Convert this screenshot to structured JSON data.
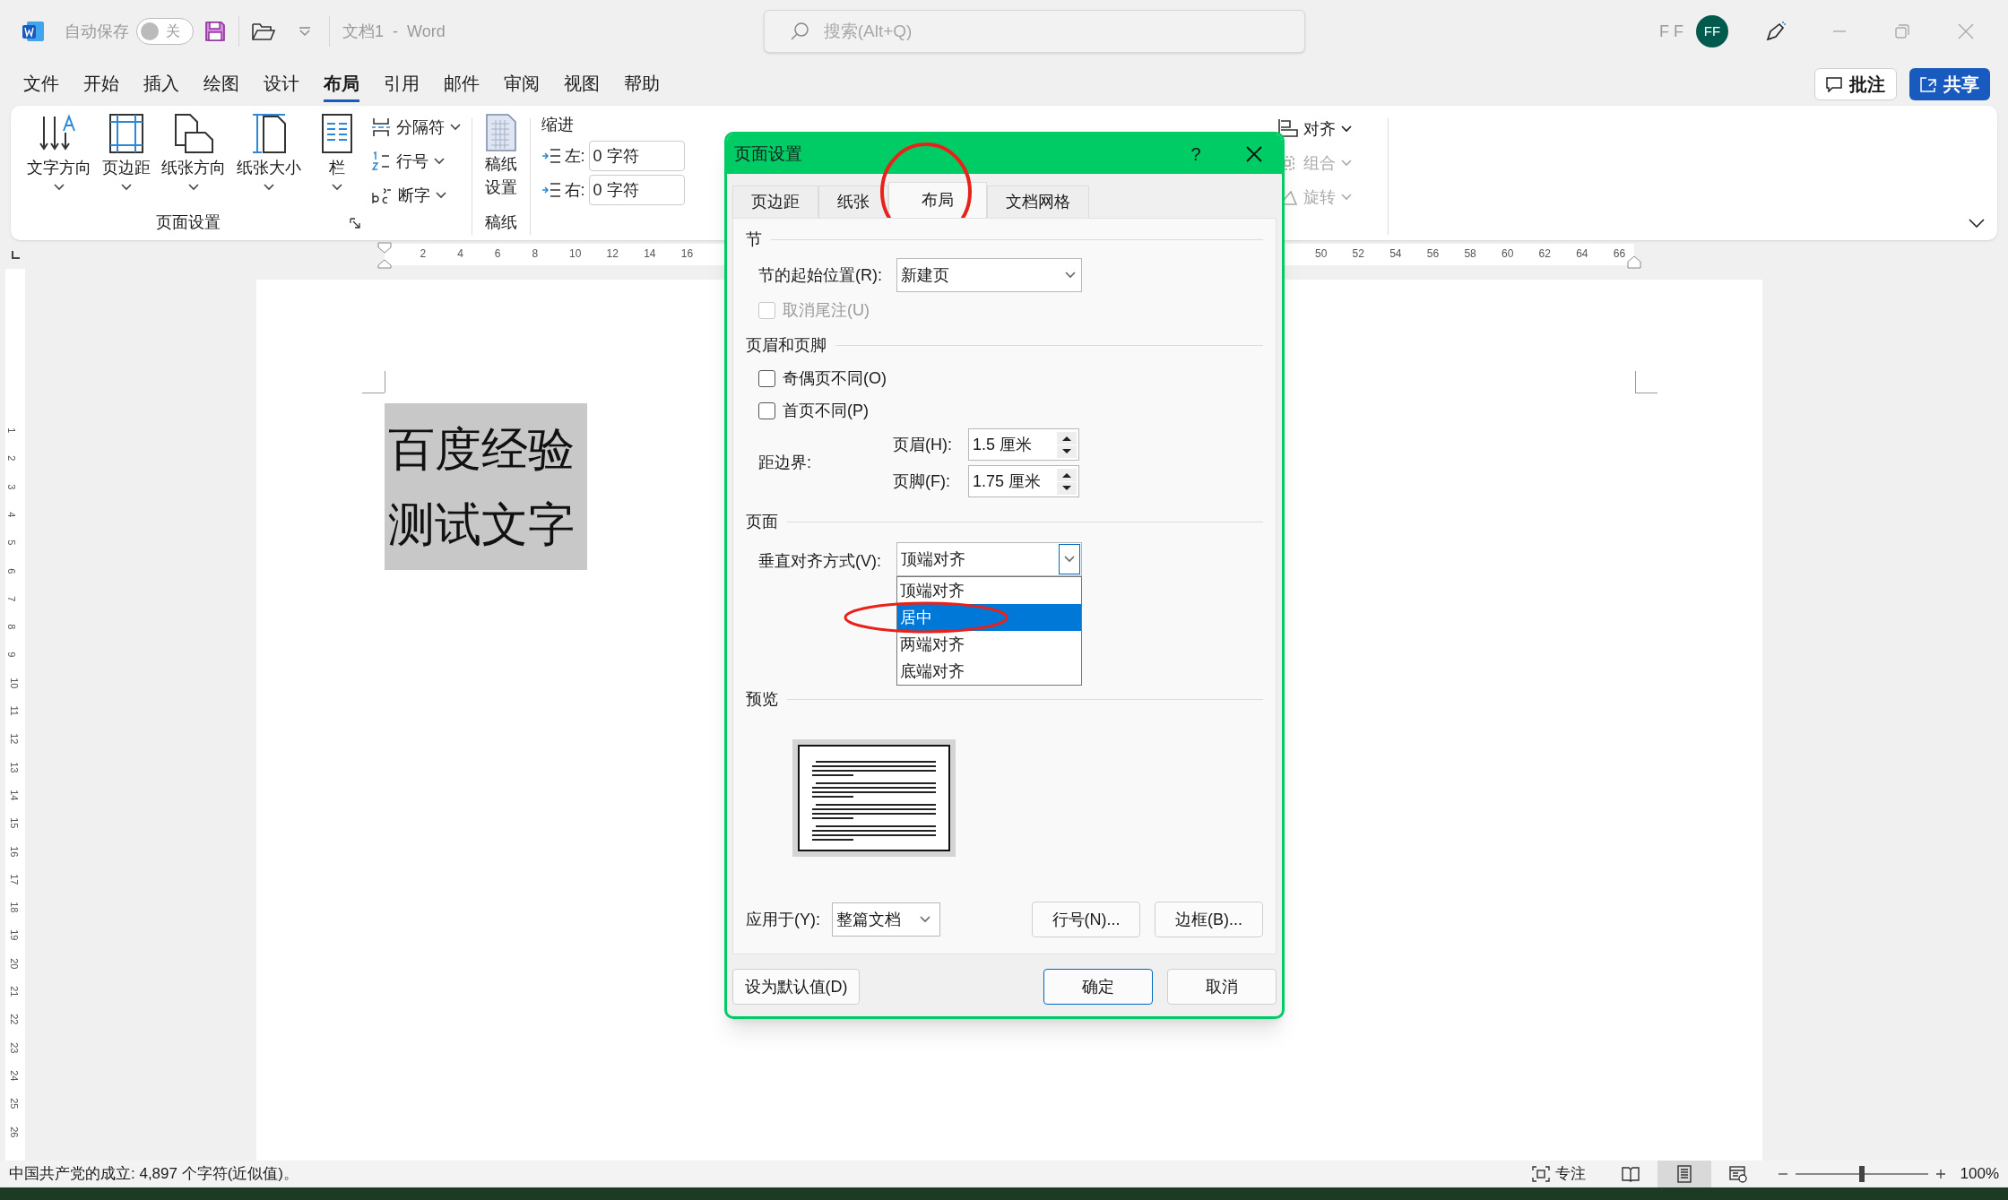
{
  "title_bar": {
    "autosave_label": "自动保存",
    "autosave_toggle": {
      "label": "关",
      "on": false
    },
    "document_title": "文档1  -  Word",
    "search": {
      "placeholder": "搜索(Alt+Q)"
    },
    "user_name": "F F",
    "avatar_initials": "FF"
  },
  "menu_tabs": [
    {
      "label": "文件",
      "selected": false
    },
    {
      "label": "开始",
      "selected": false
    },
    {
      "label": "插入",
      "selected": false
    },
    {
      "label": "绘图",
      "selected": false
    },
    {
      "label": "设计",
      "selected": false
    },
    {
      "label": "布局",
      "selected": true
    },
    {
      "label": "引用",
      "selected": false
    },
    {
      "label": "邮件",
      "selected": false
    },
    {
      "label": "审阅",
      "selected": false
    },
    {
      "label": "视图",
      "selected": false
    },
    {
      "label": "帮助",
      "selected": false
    }
  ],
  "comment_button": "批注",
  "share_button": "共享",
  "ribbon": {
    "big_buttons": [
      {
        "kind": "text-direction",
        "label": "文字方向"
      },
      {
        "kind": "margins",
        "label": "页边距"
      },
      {
        "kind": "orientation",
        "label": "纸张方向"
      },
      {
        "kind": "size",
        "label": "纸张大小"
      },
      {
        "kind": "columns",
        "label": "栏"
      }
    ],
    "small_buttons": [
      {
        "kind": "breaks",
        "label": "分隔符"
      },
      {
        "kind": "line-numbers",
        "label": "行号"
      },
      {
        "kind": "hyphenation",
        "label": "断字"
      }
    ],
    "page_setup_label": "页面设置",
    "manuscript_button": "稿纸设置",
    "manuscript_label": "稿纸",
    "indent": {
      "title": "缩进",
      "left": {
        "label": "左:",
        "value": "0 字符"
      },
      "right": {
        "label": "右:",
        "value": "0 字符"
      }
    },
    "arrange": [
      {
        "kind": "align",
        "label": "对齐",
        "disabled": false
      },
      {
        "kind": "group",
        "label": "组合",
        "disabled": true
      },
      {
        "kind": "rotate",
        "label": "旋转",
        "disabled": true
      }
    ]
  },
  "ruler": {
    "labels": [
      "2",
      "4",
      "6",
      "8",
      "10",
      "12",
      "14",
      "16",
      "50",
      "52",
      "54",
      "56",
      "58",
      "60",
      "62",
      "64",
      "66"
    ]
  },
  "vertical_ruler": {
    "labels": [
      "1",
      "2",
      "3",
      "4",
      "5",
      "6",
      "7",
      "8",
      "9",
      "10",
      "11",
      "12",
      "13",
      "14",
      "15",
      "16",
      "17",
      "18",
      "19",
      "20",
      "21",
      "22",
      "23",
      "24",
      "25",
      "26"
    ]
  },
  "document": {
    "lines": [
      "百度经验",
      "测试文字"
    ]
  },
  "dialog": {
    "title": "页面设置",
    "help": "?",
    "tabs": [
      {
        "label": "页边距",
        "selected": false
      },
      {
        "label": "纸张",
        "selected": false
      },
      {
        "label": "布局",
        "selected": true
      },
      {
        "label": "文档网格",
        "selected": false
      }
    ],
    "section": {
      "title": "节",
      "start_label": "节的起始位置(R):",
      "start_value": "新建页",
      "suppress_endnotes": {
        "label": "取消尾注(U)",
        "checked": false,
        "disabled": true
      }
    },
    "header_footer": {
      "title": "页眉和页脚",
      "checkboxes": [
        {
          "label": "奇偶页不同(O)",
          "checked": false,
          "disabled": false
        },
        {
          "label": "首页不同(P)",
          "checked": false,
          "disabled": false
        }
      ],
      "from_edge_label": "距边界:",
      "header": {
        "label": "页眉(H):",
        "value": "1.5 厘米"
      },
      "footer": {
        "label": "页脚(F):",
        "value": "1.75 厘米"
      }
    },
    "page": {
      "title": "页面",
      "valign_label": "垂直对齐方式(V):",
      "valign_value": "顶端对齐",
      "options": [
        {
          "label": "顶端对齐",
          "selected": false
        },
        {
          "label": "居中",
          "selected": true
        },
        {
          "label": "两端对齐",
          "selected": false
        },
        {
          "label": "底端对齐",
          "selected": false
        }
      ]
    },
    "preview": {
      "title": "预览"
    },
    "apply_label": "应用于(Y):",
    "apply_value": "整篇文档",
    "buttons": [
      "行号(N)...",
      "边框(B)..."
    ],
    "default_button": "设为默认值(D)",
    "ok_button": "确定",
    "cancel_button": "取消"
  },
  "status_bar": {
    "word_count": "中国共产党的成立: 4,897 个字符(近似值)。",
    "focus": "专注",
    "views": [
      {
        "kind": "read",
        "selected": false
      },
      {
        "kind": "print",
        "selected": true
      },
      {
        "kind": "web",
        "selected": false
      }
    ],
    "zoom": {
      "level": 0.5,
      "reading": "100%"
    }
  }
}
